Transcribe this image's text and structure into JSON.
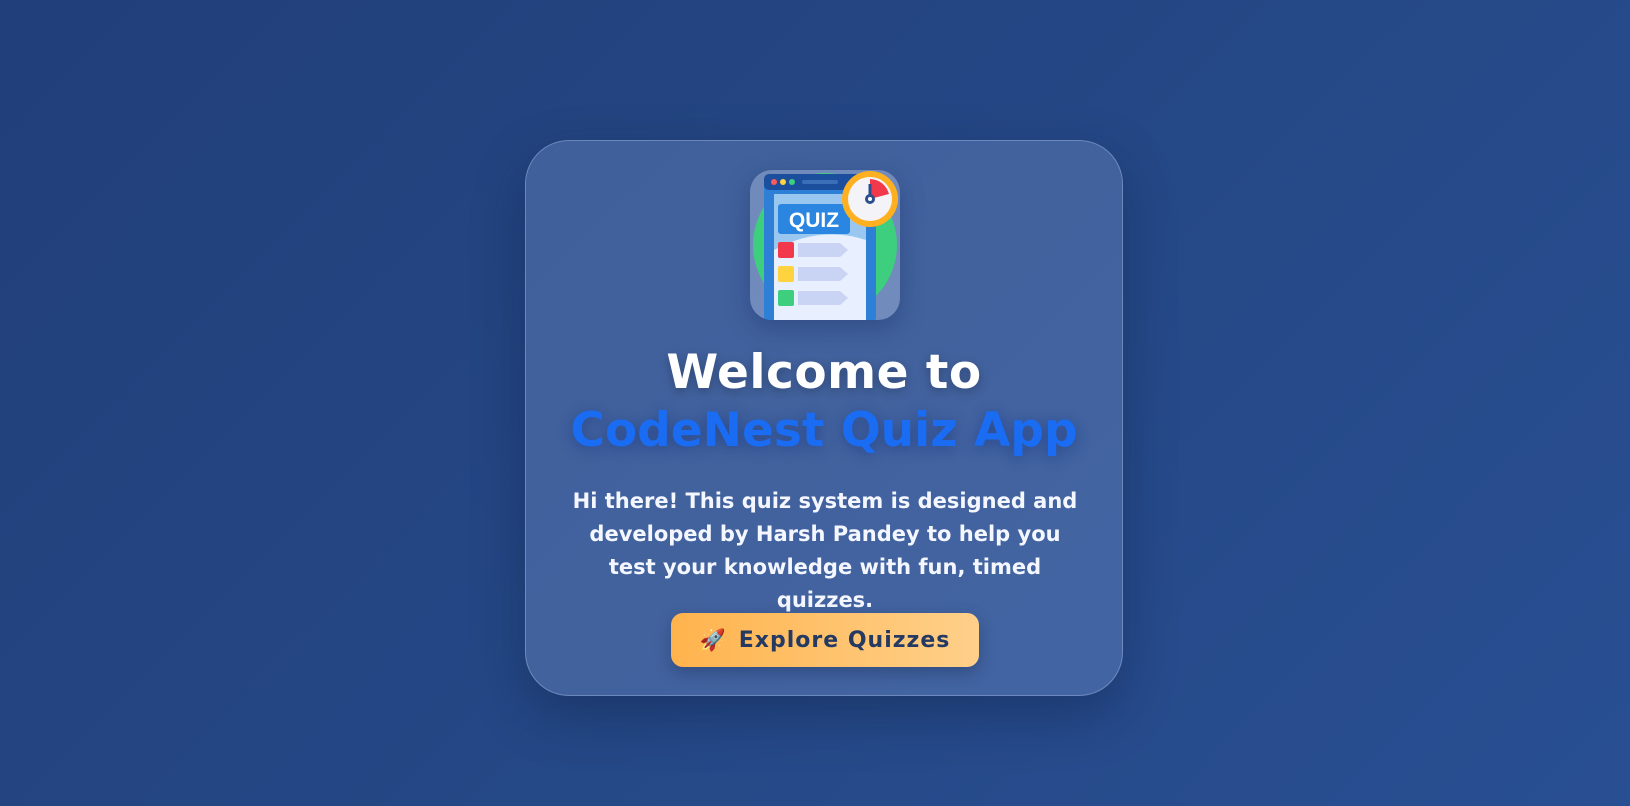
{
  "welcome": {
    "title_line1": "Welcome to",
    "title_line2": "CodeNest Quiz App",
    "description": "Hi there! This quiz system is designed and developed by Harsh Pandey to help you test your knowledge with fun, timed quizzes.",
    "logo": {
      "icon": "quiz-clipboard-icon",
      "label": "QUIZ"
    },
    "cta": {
      "icon": "rocket-icon",
      "icon_glyph": "🚀",
      "label": "Explore Quizzes"
    }
  },
  "colors": {
    "background": "#244583",
    "accent": "#1a6cf2",
    "button": "#ffc06a",
    "button_text": "#243a63"
  }
}
